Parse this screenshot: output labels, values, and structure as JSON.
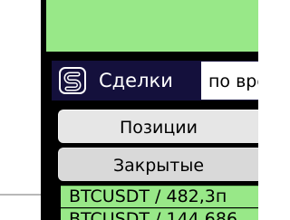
{
  "header": {
    "title": "Сделки",
    "logo_icon": "s-logo-icon",
    "sort": {
      "value": "по вре"
    }
  },
  "tabs": [
    {
      "label": "Позиции"
    },
    {
      "label": "Закрытые"
    }
  ],
  "trades": [
    {
      "label": "BTCUSDT / 482,3п"
    },
    {
      "label": "BTCUSDT / 144,686"
    }
  ],
  "colors": {
    "panel_background": "#000000",
    "header_background": "#14103c",
    "profit_green": "#98e888",
    "tab_gray": "#e6e6e6",
    "tab_closed_gray": "#d9d9d9"
  }
}
